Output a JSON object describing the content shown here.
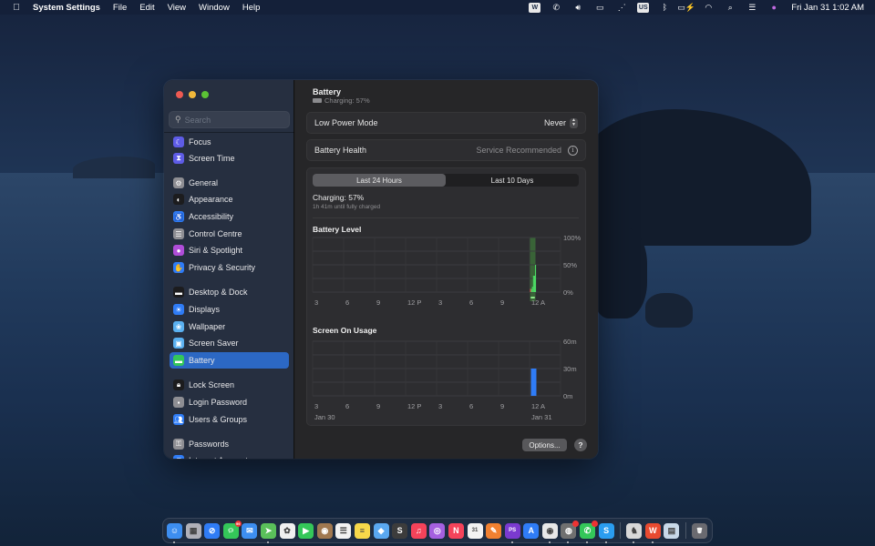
{
  "menubar": {
    "apple_icon": "",
    "app_name": "System Settings",
    "menus": [
      "File",
      "Edit",
      "View",
      "Window",
      "Help"
    ],
    "status_icons": [
      {
        "name": "wps-icon",
        "glyph": "W",
        "box": true
      },
      {
        "name": "skype-status-icon",
        "glyph": "✆",
        "box": false
      },
      {
        "name": "volume-icon",
        "glyph": "🔊︎",
        "box": false
      },
      {
        "name": "display-mirroring-icon",
        "glyph": "▭",
        "box": false
      },
      {
        "name": "brightness-icon",
        "glyph": "⋰",
        "box": false
      },
      {
        "name": "keyboard-input-icon",
        "glyph": "US",
        "box": true
      },
      {
        "name": "bluetooth-icon",
        "glyph": "ᛒ",
        "box": false
      },
      {
        "name": "battery-charging-icon",
        "glyph": "▭⚡",
        "box": false
      },
      {
        "name": "wifi-icon",
        "glyph": "◠",
        "box": false
      },
      {
        "name": "spotlight-search-icon",
        "glyph": "⌕",
        "box": false
      },
      {
        "name": "control-centre-icon",
        "glyph": "☰",
        "box": false
      },
      {
        "name": "siri-icon",
        "glyph": "●",
        "box": false
      }
    ],
    "clock": "Fri Jan 31  1:02 AM"
  },
  "window": {
    "search": {
      "placeholder": "Search",
      "value": ""
    },
    "sidebar": {
      "items": [
        {
          "label": "Focus",
          "icon": "focus-moon-icon",
          "glyph": "☾",
          "color": "#5e5ce6"
        },
        {
          "label": "Screen Time",
          "icon": "screen-time-hourglass-icon",
          "glyph": "⧗",
          "color": "#5e5ce6"
        },
        {
          "label": "General",
          "icon": "general-gear-icon",
          "glyph": "⚙",
          "color": "#8e8e93"
        },
        {
          "label": "Appearance",
          "icon": "appearance-icon",
          "glyph": "◐",
          "color": "#1c1c1e"
        },
        {
          "label": "Accessibility",
          "icon": "accessibility-icon",
          "glyph": "♿",
          "color": "#2f7cf6"
        },
        {
          "label": "Control Centre",
          "icon": "control-centre-icon",
          "glyph": "☰",
          "color": "#8e8e93"
        },
        {
          "label": "Siri & Spotlight",
          "icon": "siri-icon",
          "glyph": "●",
          "color": "#b04dd8"
        },
        {
          "label": "Privacy & Security",
          "icon": "privacy-hand-icon",
          "glyph": "✋",
          "color": "#2f7cf6"
        },
        {
          "label": "Desktop & Dock",
          "icon": "desktop-dock-icon",
          "glyph": "▬",
          "color": "#1c1c1e"
        },
        {
          "label": "Displays",
          "icon": "displays-icon",
          "glyph": "☀",
          "color": "#2f7cf6"
        },
        {
          "label": "Wallpaper",
          "icon": "wallpaper-icon",
          "glyph": "❀",
          "color": "#5ab0f0"
        },
        {
          "label": "Screen Saver",
          "icon": "screen-saver-icon",
          "glyph": "▣",
          "color": "#5ab0f0"
        },
        {
          "label": "Battery",
          "icon": "battery-icon",
          "glyph": "▬",
          "color": "#34c759",
          "active": true
        },
        {
          "label": "Lock Screen",
          "icon": "lock-screen-icon",
          "glyph": "🔒︎",
          "color": "#1c1c1e"
        },
        {
          "label": "Login Password",
          "icon": "login-password-icon",
          "glyph": "▪",
          "color": "#8e8e93"
        },
        {
          "label": "Users & Groups",
          "icon": "users-groups-icon",
          "glyph": "👥︎",
          "color": "#2f7cf6"
        },
        {
          "label": "Passwords",
          "icon": "passwords-key-icon",
          "glyph": "⚿",
          "color": "#8e8e93"
        },
        {
          "label": "Internet Accounts",
          "icon": "internet-accounts-icon",
          "glyph": "@",
          "color": "#2f7cf6"
        }
      ]
    },
    "content": {
      "title": "Battery",
      "subtitle": "Charging: 57%",
      "low_power_mode": {
        "label": "Low Power Mode",
        "value": "Never"
      },
      "battery_health": {
        "label": "Battery Health",
        "value": "Service Recommended"
      },
      "tabs": [
        {
          "label": "Last 24 Hours",
          "selected": true
        },
        {
          "label": "Last 10 Days",
          "selected": false
        }
      ],
      "charging_status": "Charging: 57%",
      "charging_eta": "1h 41m until fully charged",
      "options_label": "Options...",
      "help_label": "?"
    }
  },
  "chart_data": [
    {
      "type": "bar",
      "title": "Battery Level",
      "x_tick_labels": [
        "3",
        "6",
        "9",
        "12 P",
        "3",
        "6",
        "9",
        "12 A"
      ],
      "y_tick_labels": [
        "100%",
        "50%",
        "0%"
      ],
      "ylim": [
        0,
        100
      ],
      "grid": true,
      "charging_highlight_slot": "12 A",
      "series": [
        {
          "name": "low-battery",
          "color": "#e0524a",
          "points": [
            {
              "slot": 0,
              "value": 6
            }
          ]
        },
        {
          "name": "battery-level",
          "color": "#4cd964",
          "points": [
            {
              "slot": 1,
              "value": 6
            },
            {
              "slot": 2,
              "value": 10
            },
            {
              "slot": 3,
              "value": 30
            },
            {
              "slot": 4,
              "value": 30
            },
            {
              "slot": 5,
              "value": 50
            }
          ]
        }
      ]
    },
    {
      "type": "bar",
      "title": "Screen On Usage",
      "x_tick_labels": [
        "3",
        "6",
        "9",
        "12 P",
        "3",
        "6",
        "9",
        "12 A"
      ],
      "date_labels": [
        "Jan 30",
        "Jan 31"
      ],
      "y_tick_labels": [
        "60m",
        "30m",
        "0m"
      ],
      "ylim": [
        0,
        60
      ],
      "grid": true,
      "series": [
        {
          "name": "screen-on-minutes",
          "color": "#2f7cf6",
          "points": [
            {
              "hour_after_midnight": 0.5,
              "value": 30
            }
          ]
        }
      ]
    }
  ],
  "dock": {
    "apps": [
      {
        "name": "finder",
        "glyph": "☺",
        "color": "#3d8ef0",
        "running": true
      },
      {
        "name": "launchpad",
        "glyph": "▦",
        "color": "#b0b0b8"
      },
      {
        "name": "safari",
        "glyph": "⊘",
        "color": "#2f7cf6"
      },
      {
        "name": "messages",
        "glyph": "💬︎",
        "color": "#34c759",
        "badge": "99"
      },
      {
        "name": "mail",
        "glyph": "✉",
        "color": "#3d8ef0"
      },
      {
        "name": "maps",
        "glyph": "➤",
        "color": "#5ac05a",
        "running": true
      },
      {
        "name": "photos",
        "glyph": "✿",
        "color": "#f0f0f0"
      },
      {
        "name": "facetime",
        "glyph": "▶",
        "color": "#34c759"
      },
      {
        "name": "contacts",
        "glyph": "◉",
        "color": "#a07850"
      },
      {
        "name": "reminders",
        "glyph": "☰",
        "color": "#f2f2f2"
      },
      {
        "name": "notes",
        "glyph": "≡",
        "color": "#f7d84a"
      },
      {
        "name": "preview",
        "glyph": "◆",
        "color": "#5aa8f0"
      },
      {
        "name": "sublime-text",
        "glyph": "S",
        "color": "#3c3c3c"
      },
      {
        "name": "music",
        "glyph": "♫",
        "color": "#f5435a"
      },
      {
        "name": "podcasts",
        "glyph": "◎",
        "color": "#a560e0"
      },
      {
        "name": "news",
        "glyph": "N",
        "color": "#f5435a"
      },
      {
        "name": "calendar",
        "glyph": "31",
        "color": "#f2f2f2"
      },
      {
        "name": "pages",
        "glyph": "✎",
        "color": "#f08030"
      },
      {
        "name": "phpstorm",
        "glyph": "PS",
        "color": "#7a3ad0",
        "running": true
      },
      {
        "name": "app-store",
        "glyph": "A",
        "color": "#2f7cf6"
      },
      {
        "name": "chrome",
        "glyph": "◉",
        "color": "#e8e8e8",
        "running": true
      },
      {
        "name": "activity-monitor",
        "glyph": "◍",
        "color": "#707070",
        "badge": "",
        "running": true
      },
      {
        "name": "whatsapp",
        "glyph": "✆",
        "color": "#34c759",
        "badge": "",
        "running": true
      },
      {
        "name": "skype",
        "glyph": "S",
        "color": "#2a9df0",
        "running": true
      },
      {
        "name": "sequel-ace",
        "glyph": "♞",
        "color": "#d8d8d8",
        "separator_before": true,
        "running": true
      },
      {
        "name": "wps-office",
        "glyph": "W",
        "color": "#e84a30",
        "running": true
      },
      {
        "name": "image-viewer",
        "glyph": "▤",
        "color": "#c8d8e8"
      },
      {
        "name": "trash",
        "glyph": "🗑︎",
        "color": "#6a6a70",
        "separator_before": true
      }
    ]
  }
}
